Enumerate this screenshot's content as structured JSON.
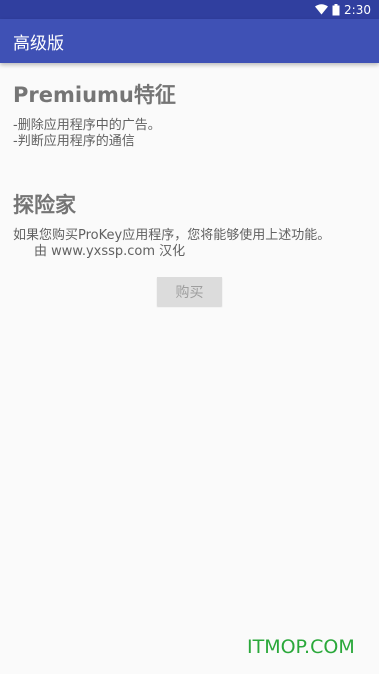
{
  "status_bar": {
    "time": "2:30",
    "wifi_icon": "wifi-icon",
    "battery_icon": "battery-icon",
    "color": "#303f9f"
  },
  "app_bar": {
    "title": "高级版",
    "color": "#3f51b5"
  },
  "features": {
    "title": "Premiumu特征",
    "items": [
      "-删除应用程序中的广告。",
      "-判断应用程序的通信"
    ]
  },
  "explorer": {
    "title": "探险家",
    "description": "如果您购买ProKey应用程序，您将能够使用上述功能。",
    "credit": "由 www.yxssp.com 汉化"
  },
  "buy_button": {
    "label": "购买"
  },
  "watermark": {
    "text": "ITMOP.COM",
    "color": "#2aa83a"
  }
}
